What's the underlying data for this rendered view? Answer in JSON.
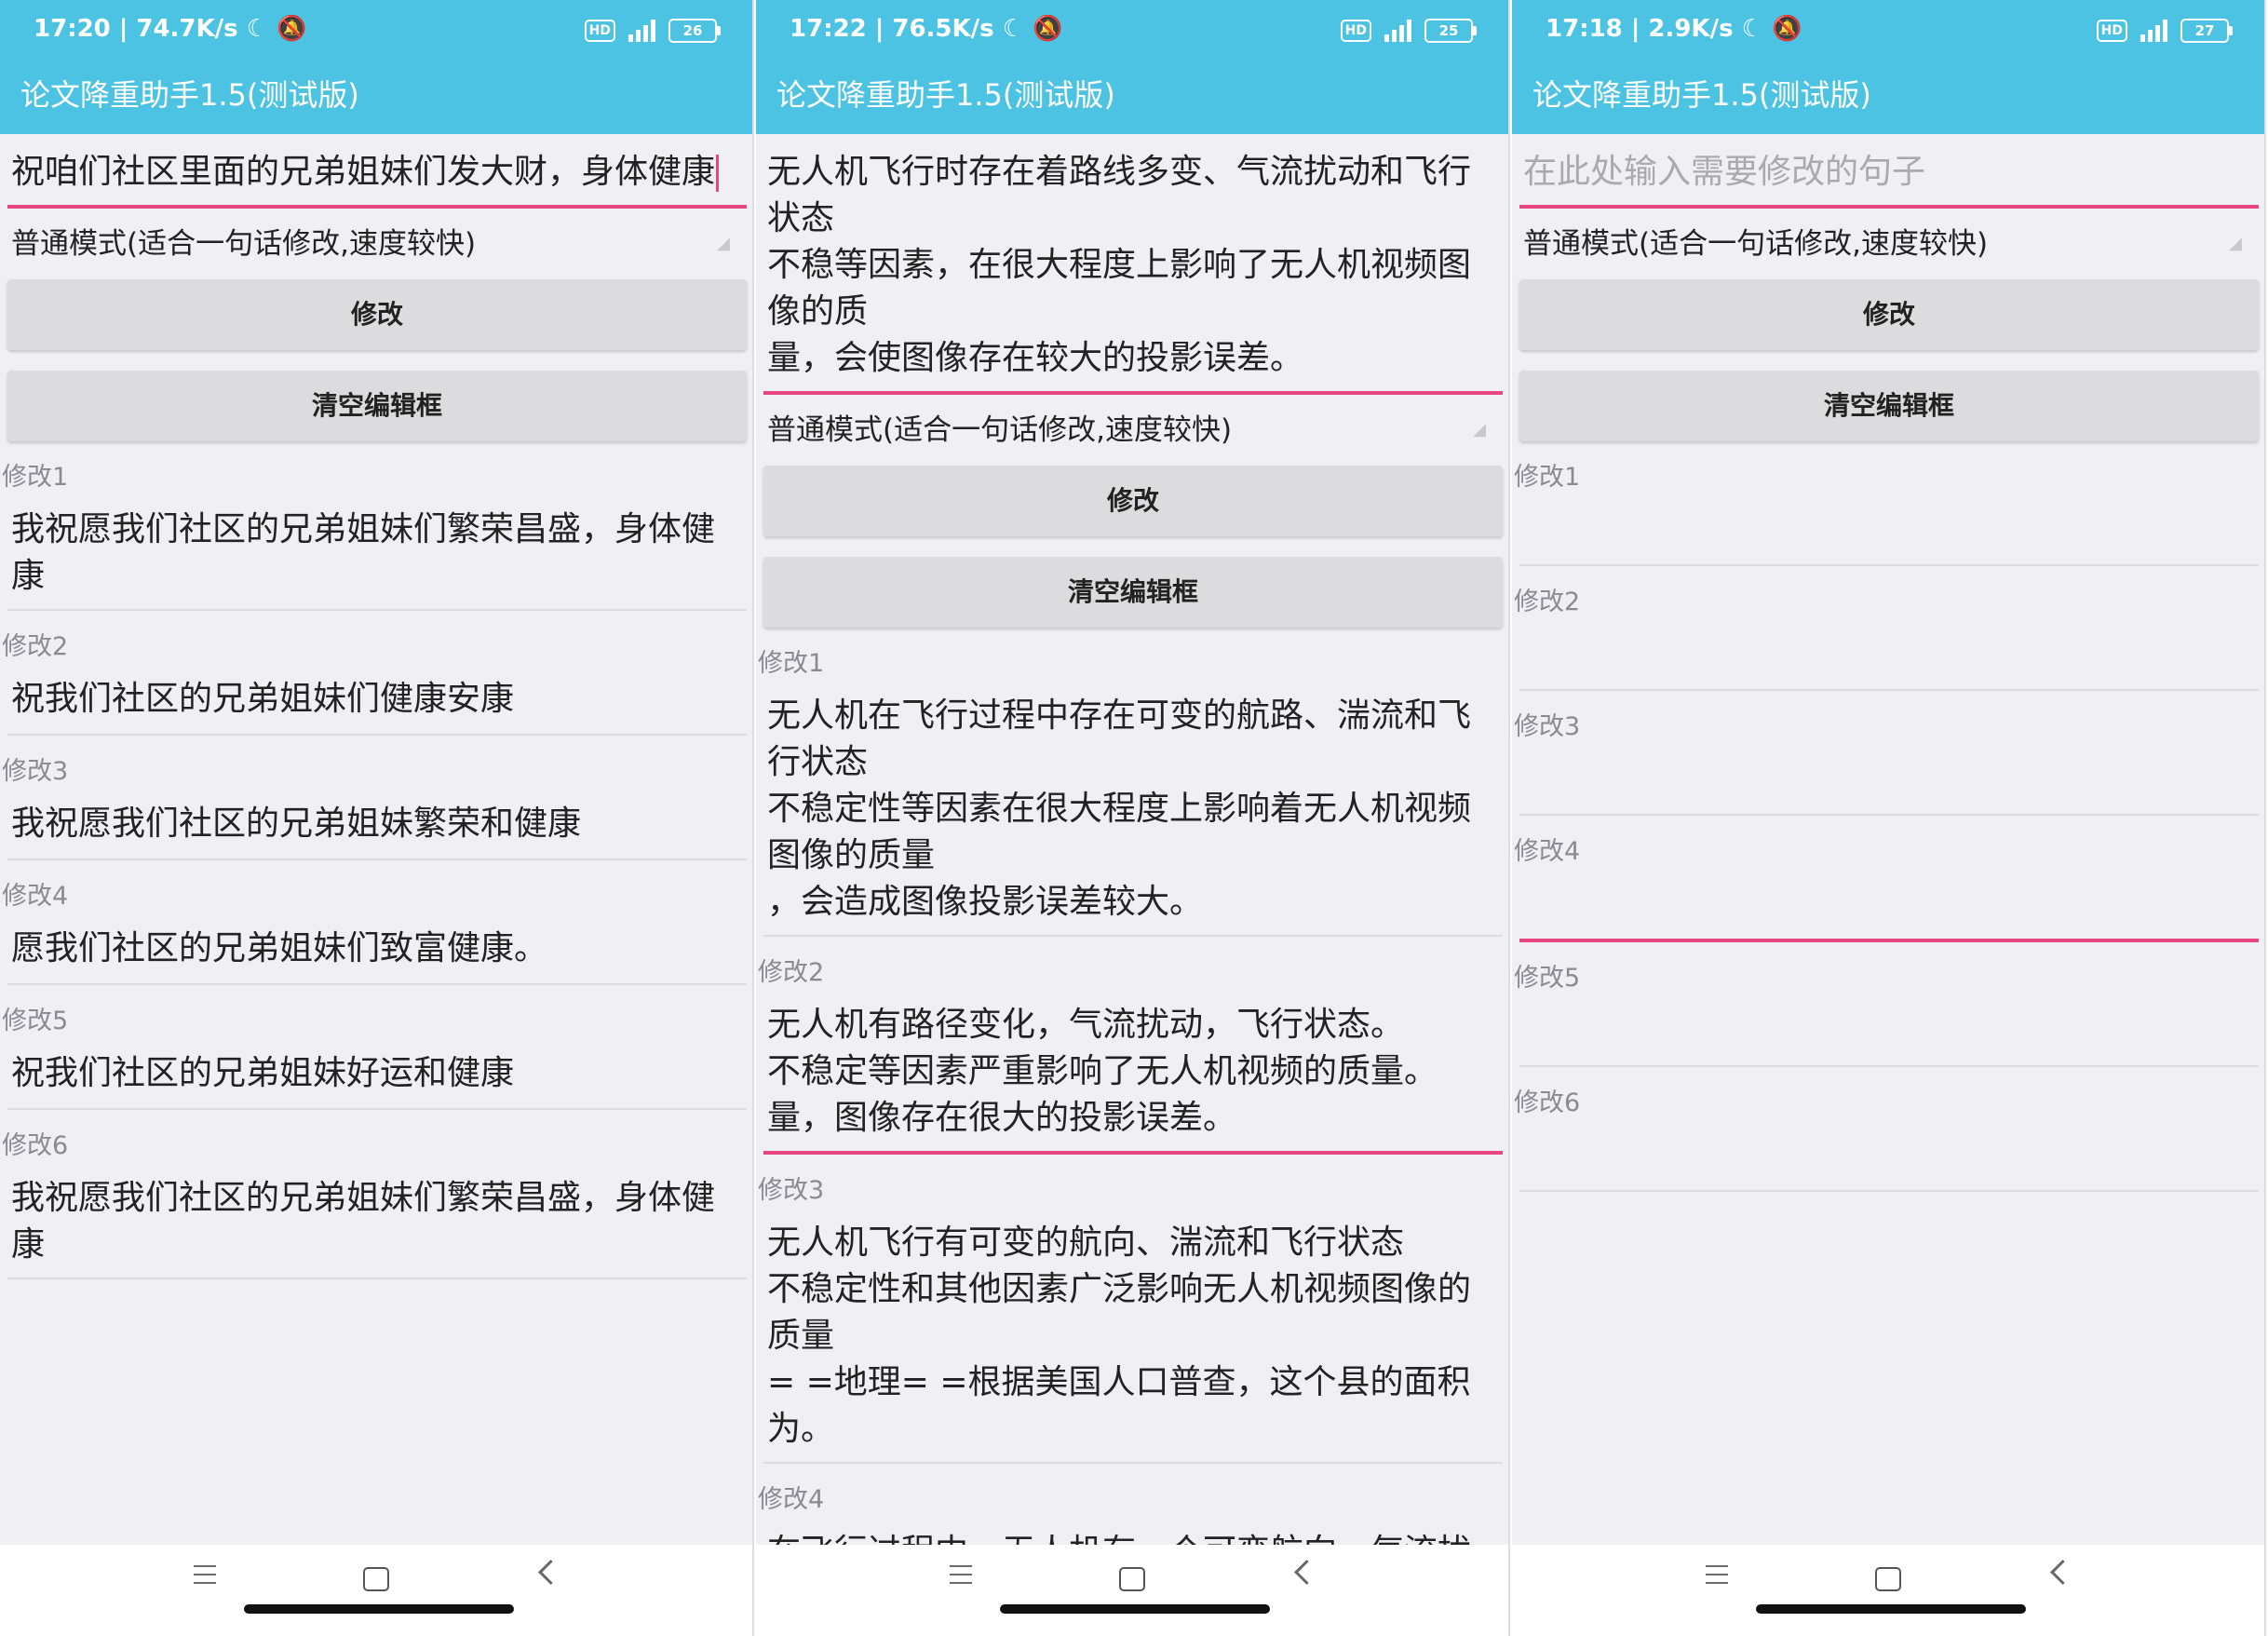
{
  "colors": {
    "accent": "#4dc3e3",
    "underline": "#e8467c",
    "background": "#f0eff4",
    "button": "#dcdcde"
  },
  "icons": [
    "moon-icon",
    "bell-off-icon",
    "hd-icon",
    "signal-icon",
    "battery-icon",
    "menu-icon",
    "home-icon",
    "back-icon"
  ],
  "phones": [
    {
      "status": {
        "time_speed": "17:20 | 74.7K/s",
        "battery": "26"
      },
      "app_title": "论文降重助手1.5(测试版)",
      "input": {
        "value": "祝咱们社区里面的兄弟姐妹们发大财，身体健康",
        "placeholder": ""
      },
      "mode": "普通模式(适合一句话修改,速度较快)",
      "modify_label": "修改",
      "clear_label": "清空编辑框",
      "results": [
        {
          "label": "修改1",
          "text": "我祝愿我们社区的兄弟姐妹们繁荣昌盛，身体健\n康"
        },
        {
          "label": "修改2",
          "text": "祝我们社区的兄弟姐妹们健康安康"
        },
        {
          "label": "修改3",
          "text": "我祝愿我们社区的兄弟姐妹繁荣和健康"
        },
        {
          "label": "修改4",
          "text": "愿我们社区的兄弟姐妹们致富健康。"
        },
        {
          "label": "修改5",
          "text": "祝我们社区的兄弟姐妹好运和健康"
        },
        {
          "label": "修改6",
          "text": "我祝愿我们社区的兄弟姐妹们繁荣昌盛，身体健\n康"
        }
      ]
    },
    {
      "status": {
        "time_speed": "17:22 | 76.5K/s",
        "battery": "25"
      },
      "app_title": "论文降重助手1.5(测试版)",
      "input": {
        "value": "无人机飞行时存在着路线多变、气流扰动和飞行\n状态\n不稳等因素，在很大程度上影响了无人机视频图\n像的质\n量，会使图像存在较大的投影误差。",
        "placeholder": ""
      },
      "mode": "普通模式(适合一句话修改,速度较快)",
      "modify_label": "修改",
      "clear_label": "清空编辑框",
      "results": [
        {
          "label": "修改1",
          "text": "无人机在飞行过程中存在可变的航路、湍流和飞\n行状态\n不稳定性等因素在很大程度上影响着无人机视频\n图像的质量\n，会造成图像投影误差较大。"
        },
        {
          "label": "修改2",
          "text": "无人机有路径变化，气流扰动，飞行状态。\n不稳定等因素严重影响了无人机视频的质量。\n量，图像存在很大的投影误差。"
        },
        {
          "label": "修改3",
          "text": "无人机飞行有可变的航向、湍流和飞行状态\n不稳定性和其他因素广泛影响无人机视频图像的\n质量\n= =地理= =根据美国人口普查，这个县的面积\n为。"
        },
        {
          "label": "修改4",
          "text": "在飞行过程中，无人机有一个可变航向，气流扰"
        }
      ]
    },
    {
      "status": {
        "time_speed": "17:18 | 2.9K/s",
        "battery": "27"
      },
      "app_title": "论文降重助手1.5(测试版)",
      "input": {
        "value": "",
        "placeholder": "在此处输入需要修改的句子"
      },
      "mode": "普通模式(适合一句话修改,速度较快)",
      "modify_label": "修改",
      "clear_label": "清空编辑框",
      "results": [
        {
          "label": "修改1",
          "text": ""
        },
        {
          "label": "修改2",
          "text": ""
        },
        {
          "label": "修改3",
          "text": ""
        },
        {
          "label": "修改4",
          "text": ""
        },
        {
          "label": "修改5",
          "text": ""
        },
        {
          "label": "修改6",
          "text": ""
        }
      ]
    }
  ]
}
